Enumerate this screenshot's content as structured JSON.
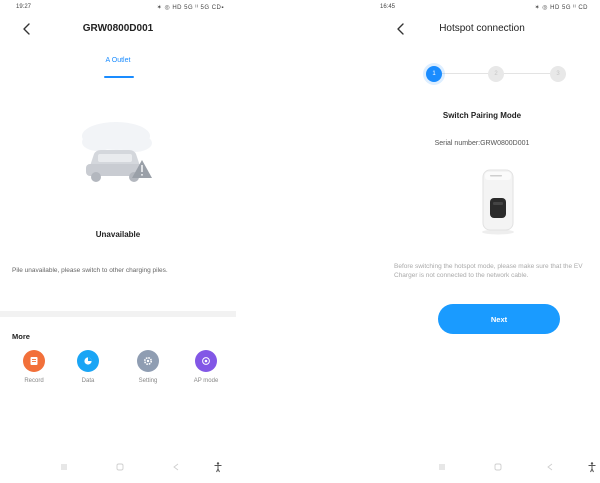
{
  "left_screen": {
    "status_bar": {
      "time": "19:27",
      "icons": "✶ ◎ HD 5G ᴵᴵ 5G CD▪"
    },
    "title": "GRW0800D001",
    "tab": "A Outlet",
    "status": "Unavailable",
    "notice": "Pile unavailable, please switch to other charging piles.",
    "more": {
      "title": "More",
      "items": [
        {
          "label": "Record",
          "icon": "record-icon",
          "color": "#f2703a"
        },
        {
          "label": "Data",
          "icon": "data-icon",
          "color": "#1aa5f5"
        },
        {
          "label": "Setting",
          "icon": "gear-icon",
          "color": "#8f9db2"
        },
        {
          "label": "AP mode",
          "icon": "ap-mode-icon",
          "color": "#8257e6"
        }
      ]
    }
  },
  "right_screen": {
    "status_bar": {
      "time": "16:45",
      "icons": "✶ ◎ HD 5G ᴵᴵ CD"
    },
    "title": "Hotspot connection",
    "steps": [
      {
        "label": "1",
        "active": true
      },
      {
        "label": "2",
        "active": false
      },
      {
        "label": "3",
        "active": false
      }
    ],
    "mode_title": "Switch Pairing Mode",
    "serial": "Serial number:GRW0800D001",
    "instructions": "Before switching the hotspot mode, please make sure that the EV Charger is not connected to the network cable.",
    "next_label": "Next"
  },
  "colors": {
    "accent": "#1a8cff",
    "button": "#1a9bff"
  }
}
